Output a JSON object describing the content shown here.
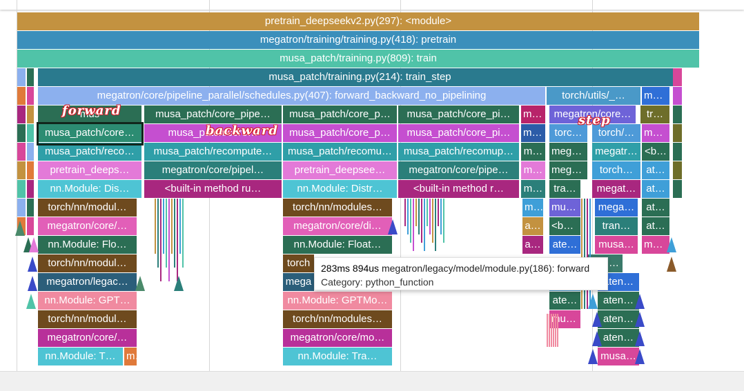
{
  "annotations": {
    "forward": "forward",
    "backward": "backward",
    "step": "step"
  },
  "tooltip": {
    "duration": "283ms 894us",
    "name": "megatron/legacy/model/module.py(186): forward",
    "category": "Category: python_function"
  },
  "rows": [
    [
      [
        "pretrain_deepseekv2.py(297): <module>",
        "#c39240"
      ]
    ],
    [
      [
        "megatron/training/training.py(418): pretrain",
        "#3b8fbb"
      ]
    ],
    [
      [
        "musa_patch/training.py(809): train",
        "#50c3a8"
      ]
    ],
    [
      [
        "musa_patch/training.py(214): train_step",
        "#2a7a8e"
      ]
    ],
    [
      [
        "megatron/core/pipeline_parallel/schedules.py(407): forward_backward_no_pipelining",
        "#8cb0ee"
      ],
      [
        "torch/utils/_…",
        "#4a99c8"
      ],
      [
        "me…",
        "#2f6fd7"
      ]
    ],
    [
      [
        "mus",
        "#2b6e54"
      ],
      [
        "musa_patch/core_pipe…",
        "#2b6e54"
      ],
      [
        "musa_patch/core_p…",
        "#2b6e54"
      ],
      [
        "musa_patch/core_pi…",
        "#2b6e54"
      ],
      [
        "me…",
        "#b8246a"
      ],
      [
        "megatron/core…",
        "#6e63d8"
      ],
      [
        "tr…",
        "#6e6e2a"
      ]
    ],
    [
      [
        "musa_patch/core…",
        "#2c8c72"
      ],
      [
        "musa_patch/core…",
        "#c54fd0"
      ],
      [
        "musa_patch/core_p…",
        "#c54fd0"
      ],
      [
        "musa_patch/core_pi…",
        "#c54fd0"
      ],
      [
        "me…",
        "#2c5ca8"
      ],
      [
        "torc…",
        "#4e9ad8"
      ],
      [
        "torch/…",
        "#4e9ad8"
      ],
      [
        "mu…",
        "#c54fd0"
      ]
    ],
    [
      [
        "musa_patch/reco…",
        "#2f9fa8"
      ],
      [
        "musa_patch/recompute…",
        "#2f9fa8"
      ],
      [
        "musa_patch/recomu…",
        "#2f9fa8"
      ],
      [
        "musa_patch/recomup…",
        "#2f9fa8"
      ],
      [
        "m…",
        "#2b6e54"
      ],
      [
        "mega…",
        "#2b6e54"
      ],
      [
        "megatr…",
        "#2f9fa8"
      ],
      [
        "<b…",
        "#2b6e54"
      ]
    ],
    [
      [
        "pretrain_deeps…",
        "#e37ad8"
      ],
      [
        "megatron/core/pipel…",
        "#2b7f7a"
      ],
      [
        "pretrain_deepsee…",
        "#e37ad8"
      ],
      [
        "megatron/core/pipe…",
        "#2b7f7a"
      ],
      [
        "m…",
        "#e37ad8"
      ],
      [
        "mega…",
        "#2b6e54"
      ],
      [
        "torch…",
        "#3f9fd8"
      ],
      [
        "at…",
        "#3f9fd8"
      ]
    ],
    [
      [
        "nn.Module: Dis…",
        "#4ec4d4"
      ],
      [
        "<built-in method ru…",
        "#a8277f"
      ],
      [
        "nn.Module: Distr…",
        "#4ec4d4"
      ],
      [
        "<built-in method r…",
        "#a8277f"
      ],
      [
        "m…",
        "#2b7f7a"
      ],
      [
        "tra…",
        "#2b6e54"
      ],
      [
        "megat…",
        "#a8277f"
      ],
      [
        "at…",
        "#3f9fd8"
      ]
    ],
    [
      [
        "torch/nn/modul…",
        "#6e4a1e"
      ],
      [
        "torch/nn/modules…",
        "#6e4a1e"
      ],
      [
        "m…",
        "#3f9fd8"
      ],
      [
        "mus…",
        "#6e63d8"
      ],
      [
        "mega…",
        "#2f6fd7"
      ],
      [
        "at…",
        "#2b6e54"
      ]
    ],
    [
      [
        "megatron/core/…",
        "#e25fb8"
      ],
      [
        "megatron/core/di…",
        "#e25fb8"
      ],
      [
        "a…",
        "#c39240"
      ],
      [
        "<bu…",
        "#2b6e54"
      ],
      [
        "tran…",
        "#2b7f7a"
      ],
      [
        "at…",
        "#2b6e54"
      ]
    ],
    [
      [
        "nn.Module: Flo…",
        "#2b6e54"
      ],
      [
        "nn.Module: Float…",
        "#2b6e54"
      ],
      [
        "a…",
        "#a8277f"
      ],
      [
        "ate…",
        "#2f6fd7"
      ],
      [
        "musa…",
        "#d8479a"
      ],
      [
        "mu…",
        "#d8479a"
      ]
    ],
    [
      [
        "torch/nn/modul…",
        "#6e4a1e"
      ],
      [
        "torch",
        "#6e4a1e"
      ],
      [
        "‹bui…",
        "#3a7a6a"
      ]
    ],
    [
      [
        "megatron/legac…",
        "#2b5e7a"
      ],
      [
        "mega",
        "#2b5e7a"
      ],
      [
        "ate…",
        "#3f9fd8"
      ],
      [
        "aten…",
        "#2f6fd7"
      ]
    ],
    [
      [
        "nn.Module: GPT…",
        "#f08aa0"
      ],
      [
        "nn.Module: GPTMo…",
        "#f08aa0"
      ],
      [
        "ate…",
        "#2b6e54"
      ],
      [
        "aten…",
        "#2b6e54"
      ]
    ],
    [
      [
        "torch/nn/modul…",
        "#6e4a1e"
      ],
      [
        "torch/nn/modules…",
        "#6e4a1e"
      ],
      [
        "mus…",
        "#d8479a"
      ],
      [
        "aten…",
        "#2b6e54"
      ]
    ],
    [
      [
        "megatron/core/…",
        "#b8309a"
      ],
      [
        "megatron/core/mo…",
        "#b8309a"
      ],
      [
        "aten…",
        "#2b6e54"
      ]
    ],
    [
      [
        "nn.Module: T…",
        "#4ec4d4"
      ],
      [
        "m",
        "#e07a3a"
      ],
      [
        "nn.Module: Tra…",
        "#4ec4d4"
      ],
      [
        "musa…",
        "#d8479a"
      ]
    ]
  ]
}
